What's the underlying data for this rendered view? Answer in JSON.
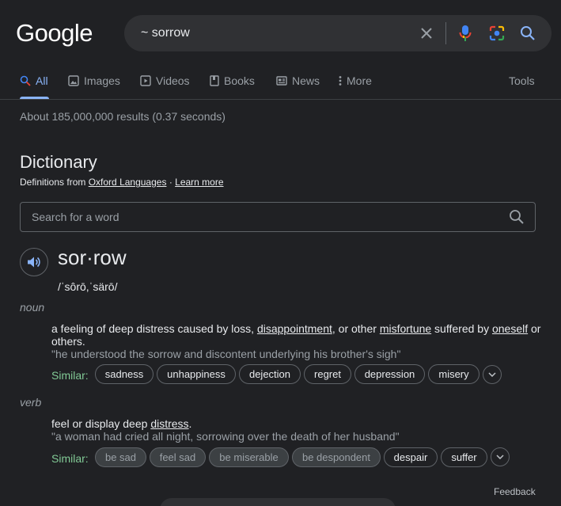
{
  "header": {
    "logo": "Google",
    "query": "~ sorrow"
  },
  "tabs": [
    {
      "label": "All"
    },
    {
      "label": "Images"
    },
    {
      "label": "Videos"
    },
    {
      "label": "Books"
    },
    {
      "label": "News"
    },
    {
      "label": "More"
    }
  ],
  "tools_label": "Tools",
  "stats": "About 185,000,000 results (0.37 seconds)",
  "dictionary": {
    "title": "Dictionary",
    "source_prefix": "Definitions from",
    "source_link": "Oxford Languages",
    "source_sep": "·",
    "learn_more": "Learn more",
    "search_placeholder": "Search for a word",
    "headword": "sor·row",
    "phonetic": "/ˈsôrō,ˈsärō/",
    "noun": {
      "pos": "noun",
      "def_parts": [
        "a feeling of deep distress caused by loss, ",
        "disappointment",
        ", or other ",
        "misfortune",
        " suffered by ",
        "oneself",
        " or others."
      ],
      "example": "\"he understood the sorrow and discontent underlying his brother's sigh\"",
      "similar_label": "Similar:",
      "similar": [
        "sadness",
        "unhappiness",
        "dejection",
        "regret",
        "depression",
        "misery"
      ]
    },
    "verb": {
      "pos": "verb",
      "def_parts": [
        "feel or display deep ",
        "distress",
        "."
      ],
      "example": "\"a woman had cried all night, sorrowing over the death of her husband\"",
      "similar_label": "Similar:",
      "similar": [
        "be sad",
        "feel sad",
        "be miserable",
        "be despondent",
        "despair",
        "suffer"
      ]
    }
  },
  "feedback": "Feedback",
  "colors": {
    "background": "#202124",
    "accent": "#8ab4f8",
    "similar_green": "#81c995"
  }
}
